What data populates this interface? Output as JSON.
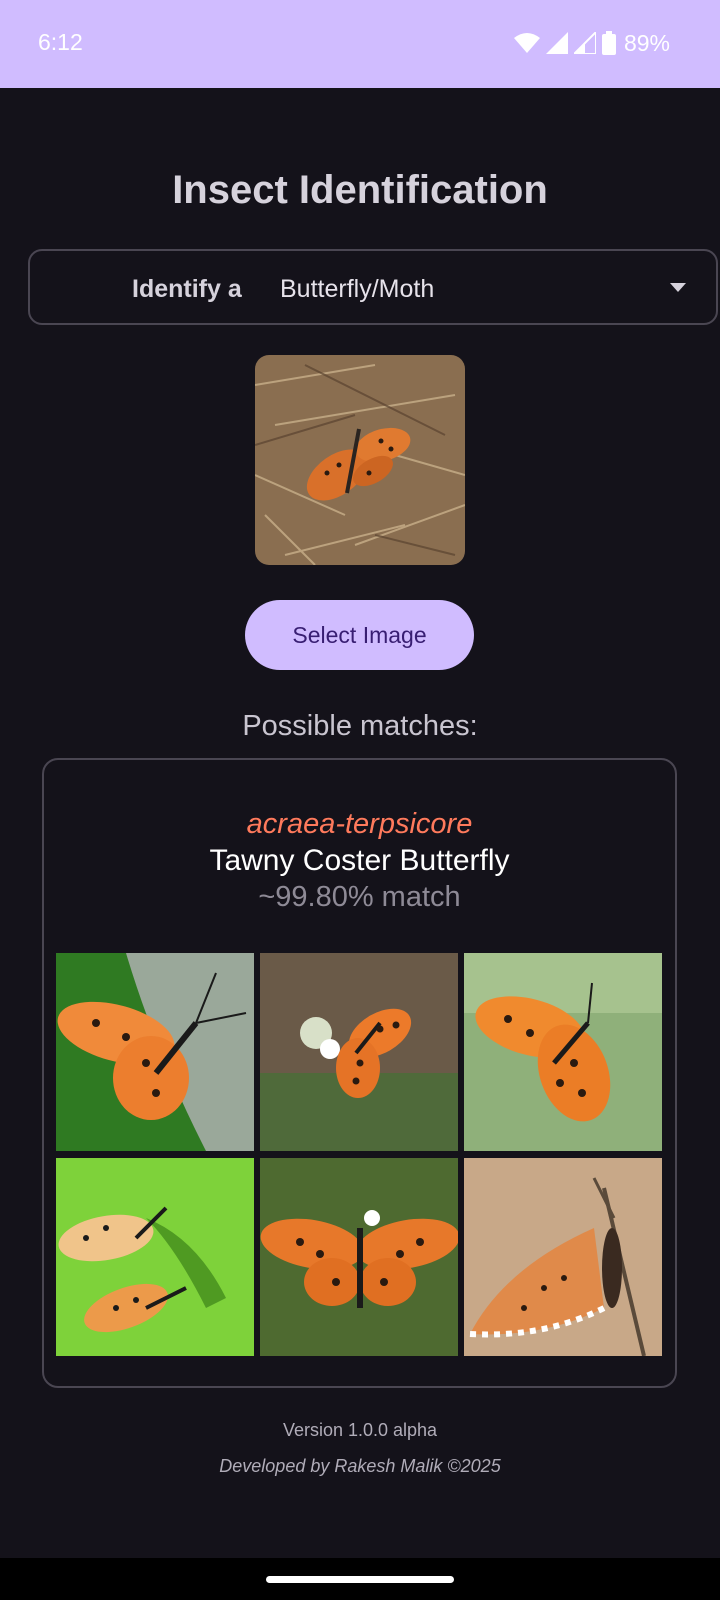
{
  "status": {
    "time": "6:12",
    "battery": "89%"
  },
  "app": {
    "title": "Insect Identification"
  },
  "dropdown": {
    "label": "Identify a",
    "value": "Butterfly/Moth"
  },
  "preview": {
    "icon": "butterfly-photo"
  },
  "actions": {
    "select_image_label": "Select Image"
  },
  "results": {
    "heading": "Possible matches:",
    "match": {
      "scientific_name": "acraea-terpsicore",
      "common_name": "Tawny Coster Butterfly",
      "match_text": "~99.80% match"
    },
    "gallery_count": 6
  },
  "footer": {
    "version": "Version 1.0.0 alpha",
    "developer": "Developed by Rakesh Malik ©2025"
  },
  "colors": {
    "accent": "#d0bcff",
    "background": "#14121a",
    "scientific_name": "#ff7a5c",
    "butterfly_orange": "#e8782a"
  }
}
